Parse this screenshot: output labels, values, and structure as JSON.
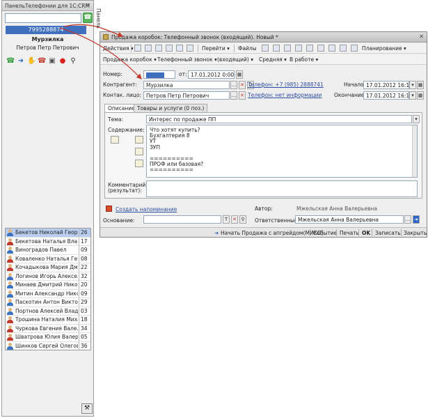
{
  "phone_panel": {
    "title": "ПанельТелефонии для 1С:CRM",
    "close": "✕",
    "dial_input": "",
    "current_number": "7995288874",
    "caller_name": "Мурзилка",
    "caller_person": "Петров Петр Петрович",
    "side_tab": "Панель",
    "contacts": [
      {
        "name": "Бекетов Николай Георг...",
        "ext": "26",
        "selected": true,
        "color": "#3a73c2"
      },
      {
        "name": "Бекетова Наталья Вла...",
        "ext": "17",
        "selected": false,
        "color": "#c0392b"
      },
      {
        "name": "Виноградов Павел",
        "ext": "09",
        "selected": false,
        "color": "#3a73c2"
      },
      {
        "name": "Коваленко Наталья Ге...",
        "ext": "08",
        "selected": false,
        "color": "#c0392b"
      },
      {
        "name": "Кочадыкова Мария Дм...",
        "ext": "22",
        "selected": false,
        "color": "#c0392b"
      },
      {
        "name": "Логинов Игорь Алексе...",
        "ext": "32",
        "selected": false,
        "color": "#3a73c2"
      },
      {
        "name": "Минаев Дмитрий Нико...",
        "ext": "20",
        "selected": false,
        "color": "#3a73c2"
      },
      {
        "name": "Митин Александр Нико...",
        "ext": "09",
        "selected": false,
        "color": "#3a73c2"
      },
      {
        "name": "Паскотин Антон Виктор...",
        "ext": "29",
        "selected": false,
        "color": "#3a73c2"
      },
      {
        "name": "Портнов Алексей Влад...",
        "ext": "03",
        "selected": false,
        "color": "#3a73c2"
      },
      {
        "name": "Трошина Наталия Миха...",
        "ext": "18",
        "selected": false,
        "color": "#c0392b"
      },
      {
        "name": "Чуркова Евгения Вале...",
        "ext": "34",
        "selected": false,
        "color": "#c0392b"
      },
      {
        "name": "Шватрова Юлия Валерь...",
        "ext": "05",
        "selected": false,
        "color": "#c0392b"
      },
      {
        "name": "Шинков Сергей Олегов...",
        "ext": "36",
        "selected": false,
        "color": "#3a73c2"
      }
    ]
  },
  "document": {
    "title": "Продажа коробок: Телефонный звонок (входящий). Новый *",
    "toolbar1": {
      "actions": "Действия ▾",
      "goto": "Перейти ▾",
      "files": "Файлы",
      "planning": "Планирование ▾"
    },
    "toolbar2": {
      "process": "Продажа коробок ▾",
      "type": "Телефонный звонок ▾",
      "direction": "(входящий) ▾",
      "priority": "Средняя ▾",
      "status": "В работе ▾"
    },
    "fields": {
      "number_label": "Номер:",
      "number_value": "",
      "from_label": "от:",
      "from_value": "17.01.2012 0:00:00",
      "contractor_label": "Контрагент:",
      "contractor_value": "Мурзилка",
      "phone_link": "Телефон: +7 (985) 2888741",
      "start_label": "Начало:",
      "start_value": "17.01.2012 16:17",
      "contact_label": "Контак. лицо:",
      "contact_value": "Петров Петр Петрович",
      "contact_phone_link": "Телефон: нет информации",
      "end_label": "Окончание:",
      "end_value": "17.01.2012 16:17"
    },
    "tabs": [
      "Описание",
      "Товары и услуги (0 поз.)"
    ],
    "subject_label": "Тема:",
    "subject_value": "Интерес по продаже ПП",
    "content_label": "Содержание:",
    "content_lines": [
      "Что хотят купить?",
      "Бухгалтерия 8",
      "УТ",
      "ЗУП",
      "",
      "==========",
      "ПРОФ или базовая?",
      "=========="
    ],
    "comment_label_1": "Комментарий",
    "comment_label_2": "(результат):",
    "reminder_link": "Создать напоминание",
    "author_label": "Автор:",
    "author_value": "Мжельская Анна Валерьевна",
    "basis_label": "Основание:",
    "basis_value": "",
    "responsible_label": "Ответственный:",
    "responsible_value": "Мжельская Анна Валерьевна",
    "bottom": {
      "start_sale": "Начать Продажа с апгрейдом(МИКО)",
      "event": "Событие",
      "print": "Печать",
      "ok": "OK",
      "save": "Записать",
      "close": "Закрыть"
    }
  },
  "colors": {
    "selection": "#3f6fbf",
    "link": "#2d4fa3",
    "arrow": "#c0392b"
  }
}
